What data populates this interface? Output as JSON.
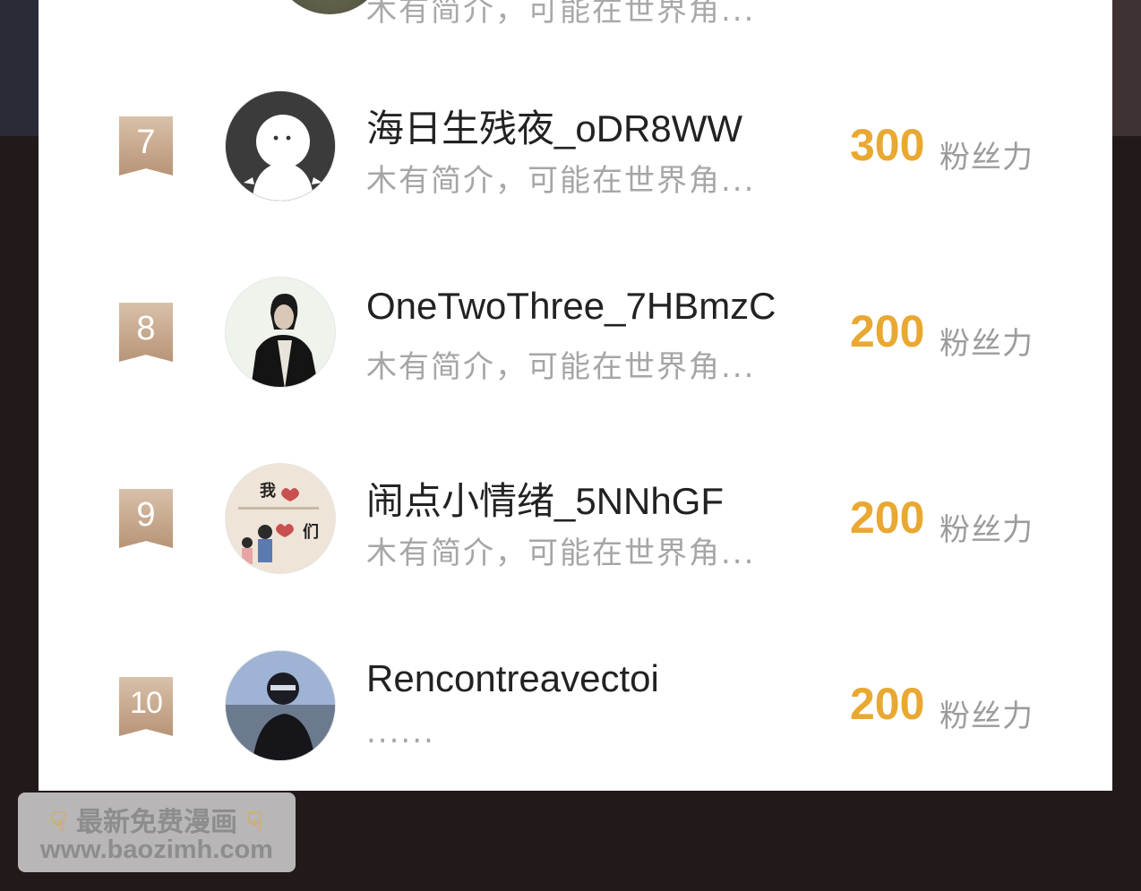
{
  "partial_row": {
    "bio": "木有简介，可能在世界角..."
  },
  "rows": [
    {
      "rank": "7",
      "name": "海日生残夜_oDR8WW",
      "bio": "木有简介，可能在世界角...",
      "fans": "300",
      "fans_label": "粉丝力"
    },
    {
      "rank": "8",
      "name": "OneTwoThree_7HBmzC",
      "bio": "木有简介，可能在世界角...",
      "fans": "200",
      "fans_label": "粉丝力"
    },
    {
      "rank": "9",
      "name": "闹点小情绪_5NNhGF",
      "bio": "木有简介，可能在世界角...",
      "fans": "200",
      "fans_label": "粉丝力"
    },
    {
      "rank": "10",
      "name": "Rencontreavectoi",
      "bio": "......",
      "fans": "200",
      "fans_label": "粉丝力"
    }
  ],
  "avatar9_text": {
    "top": "我",
    "bottom": "们"
  },
  "watermark": {
    "line1": "最新免费漫画",
    "line2": "www.baozimh.com",
    "icon": "pointing-down-hand-emoji"
  },
  "colors": {
    "accent": "#e9a831",
    "rank_badge": "#c9ab8f",
    "card": "#ffffff",
    "background": "#221a19"
  }
}
